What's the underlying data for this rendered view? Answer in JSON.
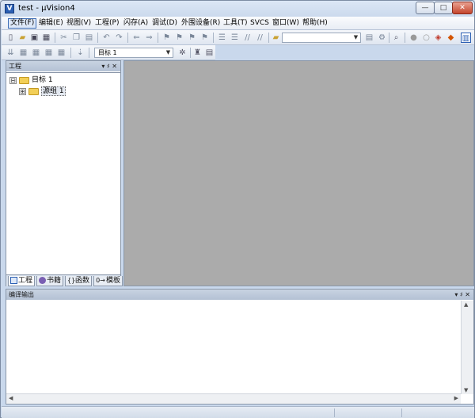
{
  "window": {
    "title": "test  - µVision4",
    "app_icon_glyph": "V",
    "controls": {
      "minimize": "—",
      "maximize": "□",
      "close": "✕"
    }
  },
  "menu": {
    "items": [
      {
        "label": "文件(F)",
        "active": true
      },
      {
        "label": "编辑(E)"
      },
      {
        "label": "视图(V)"
      },
      {
        "label": "工程(P)"
      },
      {
        "label": "闪存(A)"
      },
      {
        "label": "调试(D)"
      },
      {
        "label": "外围设备(R)"
      },
      {
        "label": "工具(T)"
      },
      {
        "label": "SVCS"
      },
      {
        "label": "窗口(W)"
      },
      {
        "label": "帮助(H)"
      }
    ]
  },
  "toolbar2": {
    "target_combo_value": "目标 1"
  },
  "project_panel": {
    "title": "工程",
    "pin_glyph": "▾ ♯ ✕",
    "tree": {
      "root": {
        "label": "目标 1",
        "toggle": "⊟"
      },
      "child": {
        "label": "源组 1",
        "toggle": "⊞"
      }
    },
    "tabs": [
      {
        "label": "工程",
        "icon": "project-tab-icon",
        "active": true
      },
      {
        "label": "书籍",
        "icon": "books-tab-icon"
      },
      {
        "label": "函数",
        "icon": "functions-tab-icon",
        "glyph": "{}"
      },
      {
        "label": "模板",
        "icon": "templates-tab-icon",
        "glyph": "0→"
      }
    ]
  },
  "build_output": {
    "title": "编译输出",
    "controls": "▾ ♯ ✕"
  },
  "colors": {
    "editor_background": "#ababab",
    "frame": "#c9d8ec",
    "panel_header": "#b4c1d4"
  }
}
